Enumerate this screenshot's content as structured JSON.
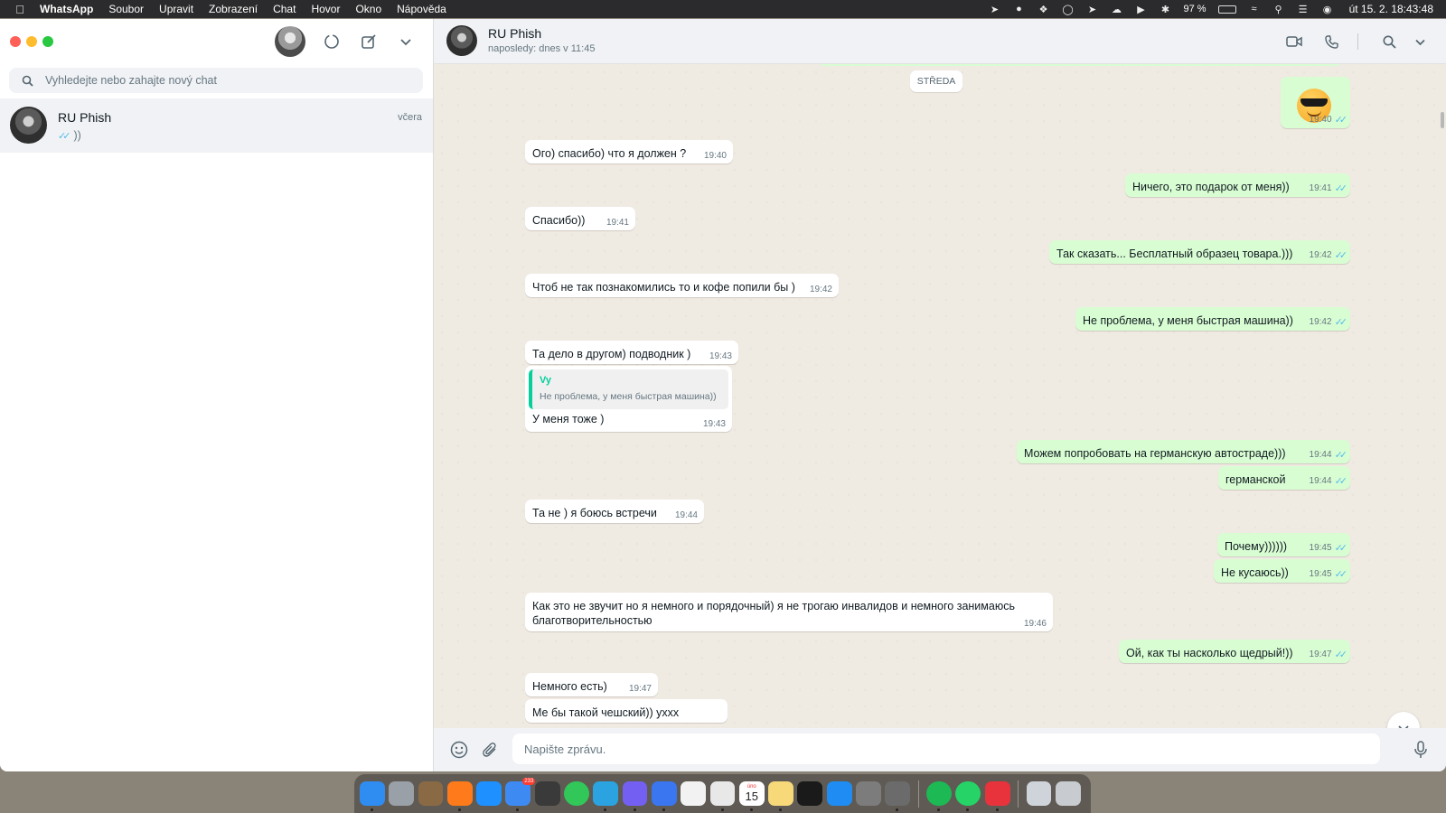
{
  "menubar": {
    "app_name": "WhatsApp",
    "menus": [
      "Soubor",
      "Upravit",
      "Zobrazení",
      "Chat",
      "Hovor",
      "Okno",
      "Nápověda"
    ],
    "battery": "97 %",
    "clock": "út 15. 2.  18:43:48"
  },
  "sidebar": {
    "search_placeholder": "Vyhledejte nebo zahajte nový chat",
    "chats": [
      {
        "name": "RU Phish",
        "time": "včera",
        "preview": "))"
      }
    ]
  },
  "chat": {
    "contact_name": "RU Phish",
    "status": "naposledy: dnes v 11:45",
    "date_divider": "STŘEDA",
    "messages": [
      {
        "dir": "out",
        "text": "",
        "emoji": "smiling-face-with-sunglasses",
        "time": "19:40"
      },
      {
        "dir": "in",
        "text": "Ого) спасибо) что я должен ?",
        "time": "19:40"
      },
      {
        "dir": "out",
        "text": "Ничего, это подарок от меня))",
        "time": "19:41"
      },
      {
        "dir": "in",
        "text": "Спасибо))",
        "time": "19:41"
      },
      {
        "dir": "out",
        "text": "Так сказать... Бесплатный образец товара.)))",
        "time": "19:42"
      },
      {
        "dir": "in",
        "text": "Чтоб не так познакомились то и кофе попили бы )",
        "time": "19:42"
      },
      {
        "dir": "out",
        "text": "Не проблема, у меня быстрая машина))",
        "time": "19:42"
      },
      {
        "dir": "in",
        "text": "Та дело в другом) подводник )",
        "time": "19:43"
      },
      {
        "dir": "in",
        "text": "У меня тоже )",
        "time": "19:43",
        "quote_author": "Vy",
        "quote_text": "Не проблема, у меня быстрая машина))"
      },
      {
        "dir": "out",
        "text": "Можем попробовать на германскую автостраде)))",
        "time": "19:44"
      },
      {
        "dir": "out",
        "text": "германской",
        "time": "19:44"
      },
      {
        "dir": "in",
        "text": "Та не ) я боюсь встречи",
        "time": "19:44"
      },
      {
        "dir": "out",
        "text": "Почему))))))",
        "time": "19:45"
      },
      {
        "dir": "out",
        "text": "Не кусаюсь))",
        "time": "19:45"
      },
      {
        "dir": "in",
        "text": "Как это не звучит но я немного и порядочный) я не трогаю инвалидов и немного занимаюсь благотворительностью",
        "time": "19:46"
      },
      {
        "dir": "out",
        "text": "Ой, как ты насколько щедрый!))",
        "time": "19:47"
      },
      {
        "dir": "in",
        "text": "Немного есть)",
        "time": "19:47"
      },
      {
        "dir": "in",
        "text": "Ме бы такой чешский)) ухxx",
        "time": ""
      }
    ],
    "composer_placeholder": "Napište zprávu."
  },
  "dock": {
    "apps": [
      {
        "icon": "finder-icon",
        "color": "#2f8cf0"
      },
      {
        "icon": "launchpad-icon",
        "color": "#9aa0a8"
      },
      {
        "icon": "photo-app-icon",
        "color": "#8a6a45"
      },
      {
        "icon": "firefox-icon",
        "color": "#ff7a1a"
      },
      {
        "icon": "safari-icon",
        "color": "#1e90ff"
      },
      {
        "icon": "mail-icon",
        "color": "#3d8bf2",
        "badge": "233"
      },
      {
        "icon": "calculator-icon",
        "color": "#3a3a3a"
      },
      {
        "icon": "messages-icon",
        "color": "#32c759"
      },
      {
        "icon": "telegram-icon",
        "color": "#2aa3e0"
      },
      {
        "icon": "viber-icon",
        "color": "#7360f2"
      },
      {
        "icon": "signal-icon",
        "color": "#3a76f0"
      },
      {
        "icon": "reminders-icon",
        "color": "#f2f2f2"
      },
      {
        "icon": "textedit-icon",
        "color": "#e8e8e8"
      },
      {
        "icon": "calendar-icon",
        "color": "#ffffff",
        "label": "15",
        "month": "úno"
      },
      {
        "icon": "notes-icon",
        "color": "#f7d97a"
      },
      {
        "icon": "chatgpt-icon",
        "color": "#1a1a1a"
      },
      {
        "icon": "app-store-icon",
        "color": "#1e8cf2"
      },
      {
        "icon": "system-preferences-icon",
        "color": "#7c7c7c"
      },
      {
        "icon": "preview-icon",
        "color": "#6b6b6b"
      },
      {
        "icon": "spotify-icon",
        "color": "#1db954"
      },
      {
        "icon": "whatsapp-icon",
        "color": "#25d366"
      },
      {
        "icon": "airmail-icon",
        "color": "#e8323c"
      },
      {
        "icon": "window-thumbnail-icon",
        "color": "#cfd4da"
      },
      {
        "icon": "trash-icon",
        "color": "#c8cbcf"
      }
    ]
  }
}
